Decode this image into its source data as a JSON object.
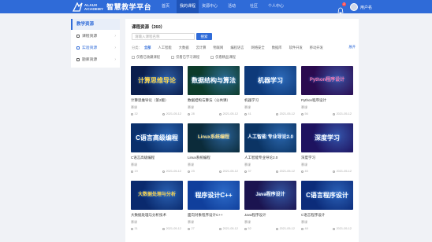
{
  "header": {
    "logo_en_line1": "ALAUX",
    "logo_en_line2": "ACADEMY",
    "logo_cn": "智慧教学平台",
    "nav": [
      "首页",
      "我的课程",
      "资源中心",
      "活动",
      "社区",
      "个人中心"
    ],
    "active_nav_index": 1,
    "notification_count": "2",
    "user_name": "用户名"
  },
  "sidebar": {
    "title": "教学资源",
    "items": [
      {
        "label": "课程资源",
        "icon": "book-icon"
      },
      {
        "label": "实验资源",
        "icon": "flask-icon"
      },
      {
        "label": "题库资源",
        "icon": "list-icon"
      }
    ],
    "active_index": 1
  },
  "main": {
    "title": "课程资源（260）",
    "search_placeholder": "请输入课程名称",
    "search_button": "搜索",
    "filter_label": "分类：",
    "filters": [
      "全部",
      "人工智能",
      "大数据",
      "云计算",
      "物联网",
      "编程语言",
      "网络安全",
      "数据库",
      "软件开发",
      "移动开发"
    ],
    "active_filter_index": 0,
    "filter_more": "展开",
    "options": [
      "仅看已收藏课程",
      "仅看已学习课程",
      "仅看精品课程"
    ],
    "accent": "#2f6bd8"
  },
  "courses": [
    {
      "thumb_text": "计算思维导论",
      "thumb_bg": "#0b1e4d",
      "thumb_fg": "#ffd54a",
      "title": "计算思维导论（第2版）",
      "type": "慕课",
      "views": "32",
      "time": "2021-05-12"
    },
    {
      "thumb_text": "数据结构与算法",
      "thumb_bg": "#0d3b2a",
      "thumb_fg": "#ffffff",
      "title": "数据结构与算法（公共课）",
      "type": "慕课",
      "views": "28",
      "time": "2021-05-12"
    },
    {
      "thumb_text": "机器学习",
      "thumb_bg": "#0e3a7a",
      "thumb_fg": "#ffffff",
      "title": "机器学习",
      "type": "慕课",
      "views": "41",
      "time": "2021-05-12"
    },
    {
      "thumb_text": "Python程序设计",
      "thumb_bg": "#2a0b4f",
      "thumb_fg": "#ff7ab0",
      "title": "Python程序设计",
      "type": "慕课",
      "views": "56",
      "time": "2021-05-12"
    },
    {
      "thumb_text": "C语言高级编程",
      "thumb_bg": "#0a2f6b",
      "thumb_fg": "#ffffff",
      "title": "C语言高级编程",
      "type": "慕课",
      "views": "19",
      "time": "2021-05-12"
    },
    {
      "thumb_text": "Linux系统编程",
      "thumb_bg": "#0b2b3a",
      "thumb_fg": "#ffe28a",
      "title": "Linux系统编程",
      "type": "慕课",
      "views": "23",
      "time": "2021-05-12"
    },
    {
      "thumb_text": "人工智能 专业导论2.0",
      "thumb_bg": "#0b3464",
      "thumb_fg": "#ffffff",
      "title": "人工智能专业导论2.0",
      "type": "慕课",
      "views": "37",
      "time": "2021-05-12"
    },
    {
      "thumb_text": "深度学习",
      "thumb_bg": "#1e1360",
      "thumb_fg": "#ffffff",
      "title": "深度学习",
      "type": "慕课",
      "views": "45",
      "time": "2021-05-12"
    },
    {
      "thumb_text": "大数据处理与分析",
      "thumb_bg": "#0a2a6e",
      "thumb_fg": "#ffd54a",
      "title": "大数据处理与分析技术",
      "type": "慕课",
      "views": "31",
      "time": "2021-05-12"
    },
    {
      "thumb_text": "程序设计C++",
      "thumb_bg": "#103f9c",
      "thumb_fg": "#ffffff",
      "title": "面向对象程序设计C++",
      "type": "慕课",
      "views": "27",
      "time": "2021-05-12"
    },
    {
      "thumb_text": "Java程序设计",
      "thumb_bg": "#1b1450",
      "thumb_fg": "#ffffff",
      "title": "Java程序设计",
      "type": "慕课",
      "views": "52",
      "time": "2021-05-12"
    },
    {
      "thumb_text": "C语言程序设计",
      "thumb_bg": "#0c2c7a",
      "thumb_fg": "#ffffff",
      "title": "C语言程序设计",
      "type": "慕课",
      "views": "48",
      "time": "2021-05-12"
    }
  ]
}
